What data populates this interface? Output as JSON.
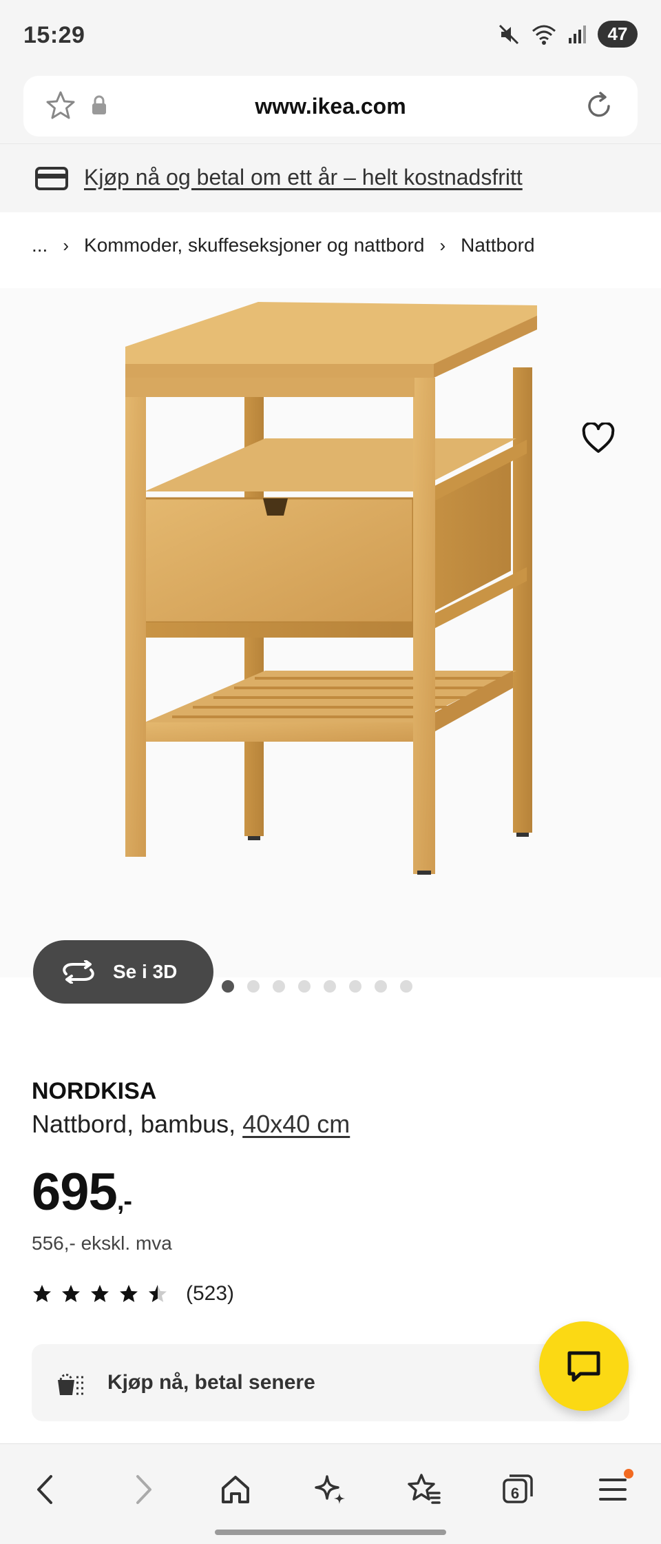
{
  "status_bar": {
    "time": "15:29",
    "battery": "47"
  },
  "browser": {
    "url": "www.ikea.com",
    "tab_count": "6"
  },
  "promo": {
    "text": "Kjøp nå og betal om ett år – helt kostnadsfritt"
  },
  "breadcrumb": {
    "ellipsis": "...",
    "category": "Kommoder, skuffeseksjoner og nattbord",
    "current": "Nattbord"
  },
  "gallery": {
    "view_3d_label": "Se i 3D",
    "image_count": 8,
    "active_index": 0
  },
  "product": {
    "name": "NORDKISA",
    "description": "Nattbord, bambus,",
    "size": "40x40 cm",
    "price": "695",
    "price_suffix": ",-",
    "price_excl_vat": "556,- ekskl. mva",
    "rating": 4.5,
    "rating_count": "(523)"
  },
  "bnpl": {
    "label": "Kjøp nå, betal senere"
  },
  "colors": {
    "accent_yellow": "#fbd914",
    "notification": "#f26a21",
    "wood": "#d6a55c"
  },
  "icons": [
    "star-icon",
    "lock-icon",
    "reload-icon",
    "card-icon",
    "heart-icon",
    "rotate-3d-icon",
    "chat-icon",
    "back-icon",
    "forward-icon",
    "home-icon",
    "sparkle-icon",
    "bookmarks-icon",
    "tabs-icon",
    "menu-icon"
  ]
}
